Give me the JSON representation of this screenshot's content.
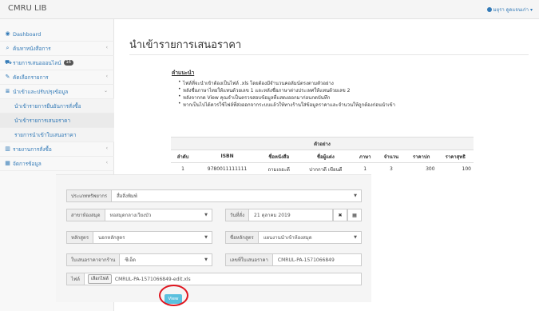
{
  "app": {
    "brand": "CMRU LIB",
    "user": "มยุรา ดูดแจนเก่า"
  },
  "sidebar": {
    "items": [
      {
        "label": "Dashboard"
      },
      {
        "label": "ค้นหาหนังสือการ"
      },
      {
        "label": "รายการเสนอออนไลน์",
        "badge": "16"
      },
      {
        "label": "คัดเลือกรายการ"
      },
      {
        "label": "นำเข้าและปรับปรุงข้อมูล"
      },
      {
        "label": "นำเข้ารายการยืนยันการสั่งซื้อ"
      },
      {
        "label": "นำเข้ารายการเสนอราคา"
      },
      {
        "label": "รายการนำเข้าใบเสนอราคา"
      },
      {
        "label": "รายงานการสั่งซื้อ"
      },
      {
        "label": "จัดการข้อมูล"
      }
    ]
  },
  "main": {
    "title": "นำเข้ารายการเสนอราคา",
    "instructions_title": "คำแนะนำ",
    "instructions": [
      "ไฟล์ที่จะนำเข้าต้องเป็นไฟล์ .xls โดยต้องมีจำนวนคอลัมน์ตรงตามตัวอย่าง",
      "หลังชื่อภาษาไทยให้แทนด้วยเลข 1 และหลังชื่อภาษาต่างประเทศให้แทนด้วยเลข 2",
      "หลังจากกด View คุณจำเป็นตรวจสอบข้อมูลที่แสดงออกมาก่อนกดบันทึก",
      "หากเป็นไปได้ควรใช้ไฟล์ที่ส่งออกจากระบบแล้วให้ทางร้านใส่ข้อมูลราคาและจำนวนให้ถูกต้องก่อนนำเข้า"
    ],
    "example": {
      "caption": "ตัวอย่าง",
      "columns": [
        "ลำดับ",
        "ISBN",
        "ชื่อหนังสือ",
        "ชื่อผู้แต่ง",
        "ภาษา",
        "จำนวน",
        "ราคาปก",
        "ราคาสุทธิ"
      ],
      "row": [
        "1",
        "9780011111111",
        "ถามเถอะดี",
        "ปากกาดี เขียนดี",
        "1",
        "3",
        "300",
        "100"
      ]
    },
    "form": {
      "resource_type": {
        "label": "ประเภททรัพยากร",
        "value": "สื่อสิ่งพิมพ์"
      },
      "library": {
        "label": "สาขาห้องสมุด",
        "value": "หอสมุดกลางเวียงบัว"
      },
      "order_date": {
        "label": "วันที่สั่ง",
        "value": "21 ตุลาคม 2019"
      },
      "curriculum": {
        "label": "หลักสูตร",
        "value": "นอกหลักสูตร"
      },
      "course": {
        "label": "ชื่อหลักสูตร",
        "value": "แผนงานนำเข้าห้องสมุด"
      },
      "quote_from": {
        "label": "ใบเสนอราคาจากร้าน",
        "value": "ซีเอ็ด"
      },
      "quote_no": {
        "label": "เลขที่ใบเสนอราคา",
        "value": "CMRUL-PA-1571066849"
      },
      "file": {
        "label": "ไฟล์",
        "button": "เลือกไฟล์",
        "value": "CMRUL-PA-1571066849-edit.xls"
      },
      "view_button": "View"
    }
  },
  "colors": {
    "accent": "#337ab7",
    "view_button": "#5bc0de",
    "highlight_ring": "#e0141e"
  }
}
